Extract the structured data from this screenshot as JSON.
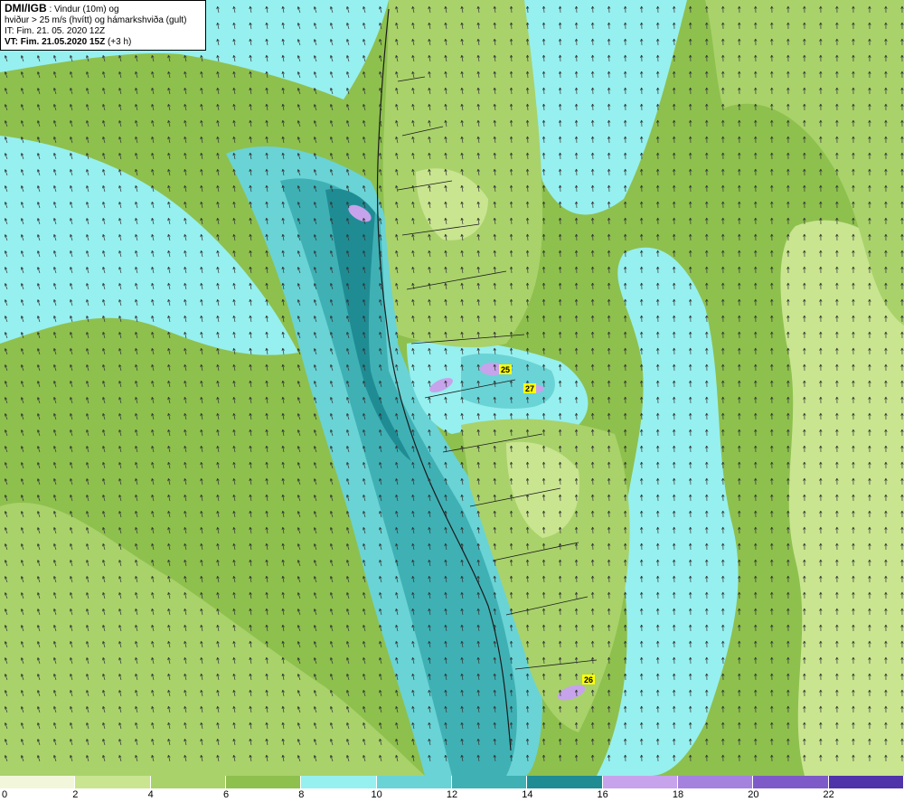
{
  "header": {
    "org": "DMI/IGB",
    "title_suffix": " : Vindur (10m) og",
    "line2": "hviður > 25 m/s (hvítt) og hámarkshviða (gult)",
    "it_line": "IT: Fim. 21. 05. 2020 12Z",
    "vt_bold": "VT: Fim. 21.05.2020 15Z",
    "vt_offset": " (+3 h)"
  },
  "gust_markers": [
    {
      "label": "25"
    },
    {
      "label": "27"
    },
    {
      "label": "26"
    }
  ],
  "legend": {
    "ticks": [
      "0",
      "2",
      "4",
      "6",
      "8",
      "10",
      "12",
      "14",
      "16",
      "18",
      "20",
      "22"
    ],
    "colors": [
      "#f2f7dc",
      "#c9e590",
      "#a9d26b",
      "#8ec04e",
      "#96f0ef",
      "#6ad3d5",
      "#3fb1b5",
      "#1f8c94",
      "#c7a3ec",
      "#a582de",
      "#7e5ac8",
      "#4f33a8"
    ]
  },
  "palette": {
    "calm": "#c9e590",
    "light": "#a9d26b",
    "moderate": "#8ec04e",
    "fresh": "#96f0ef",
    "strong": "#6ad3d5",
    "gale": "#3fb1b5",
    "storm": "#1f8c94",
    "gust": "#c7a3ec",
    "gust_label_bg": "#ffff00"
  }
}
